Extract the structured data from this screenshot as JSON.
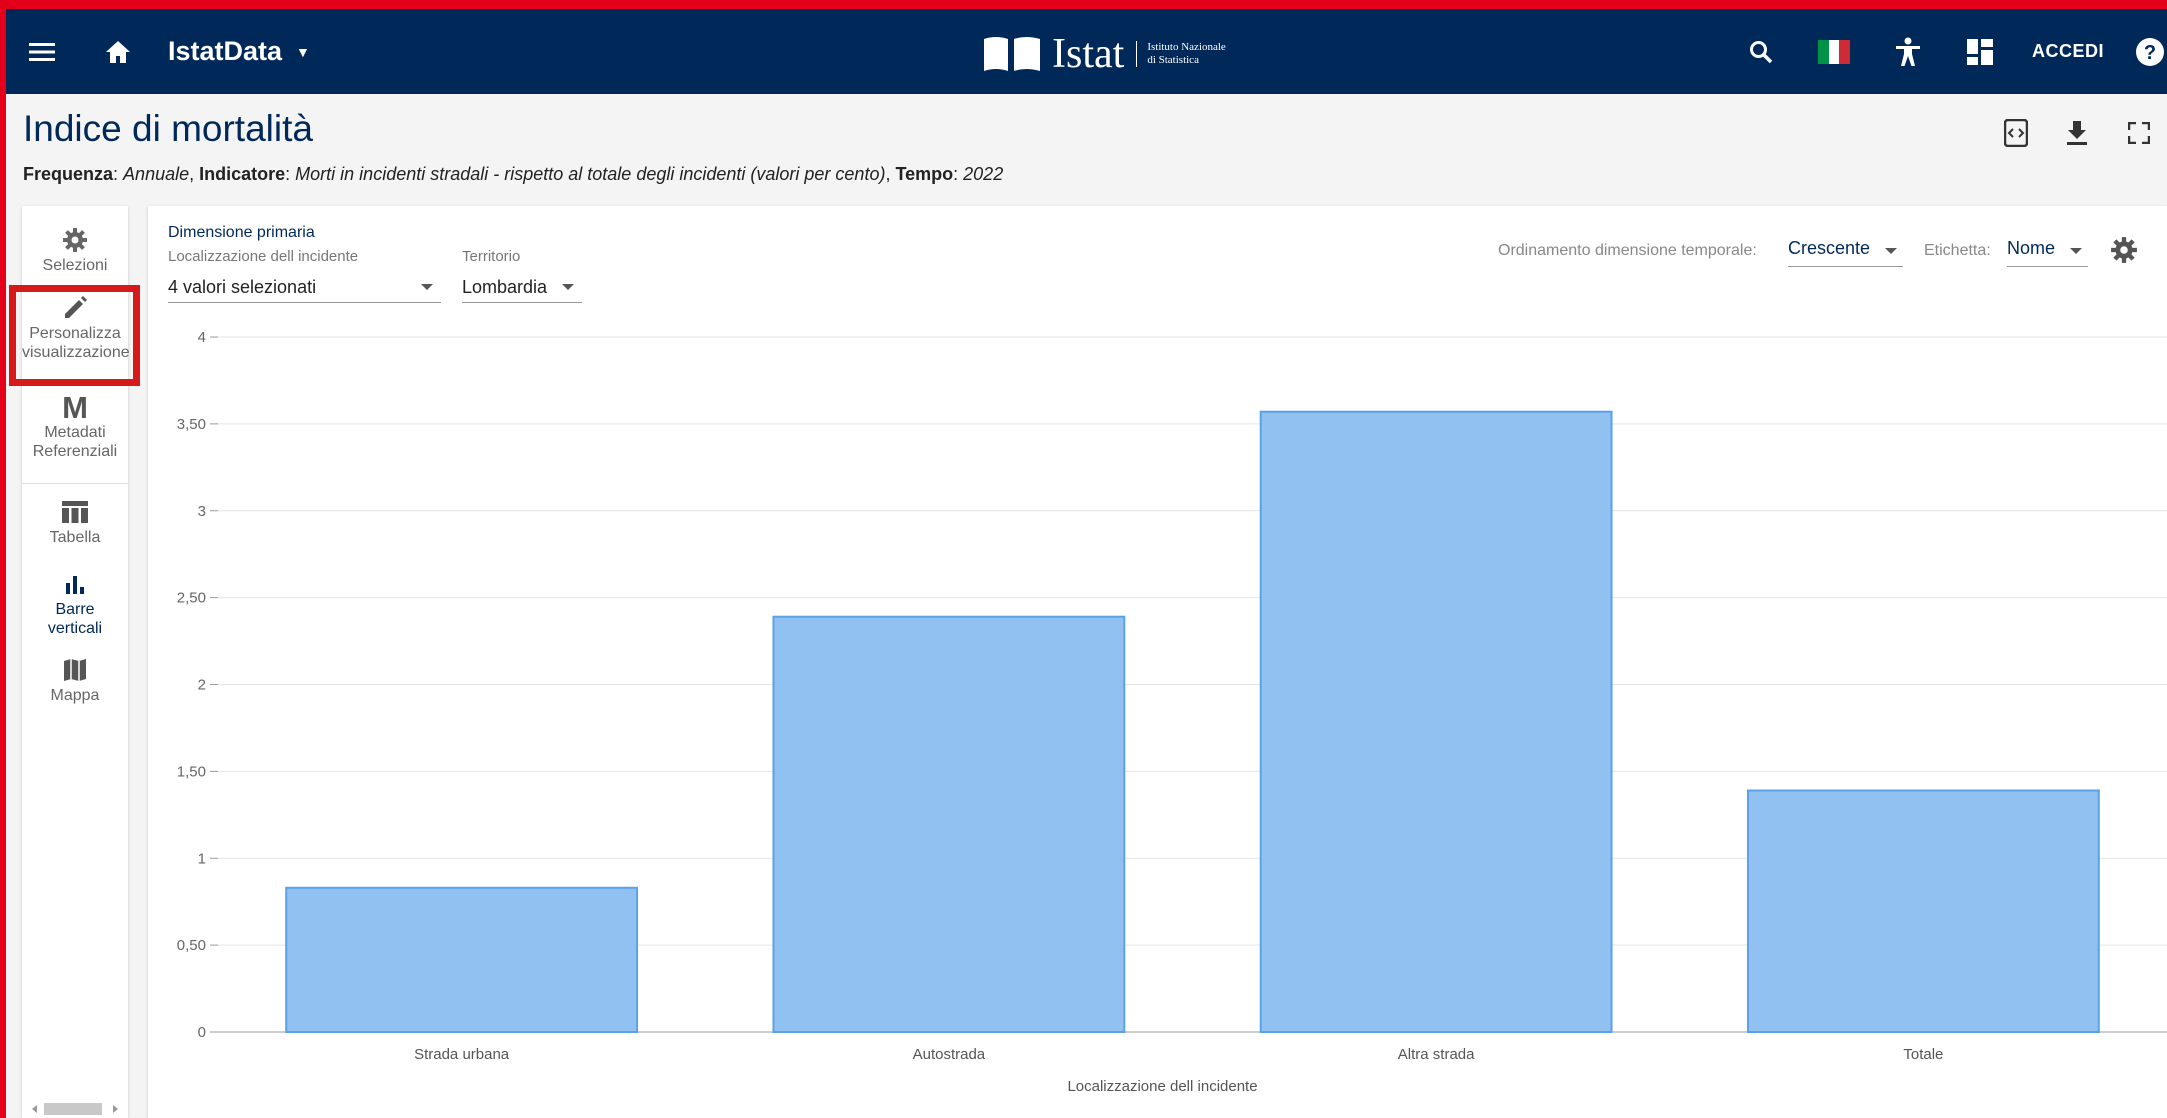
{
  "header": {
    "app_name": "IstatData",
    "logo_word": "Istat",
    "logo_sub_line1": "Istituto Nazionale",
    "logo_sub_line2": "di Statistica",
    "login_label": "ACCEDI",
    "colors": {
      "bar": "#00295a",
      "flag_green": "#009246",
      "flag_white": "#ffffff",
      "flag_red": "#ce2b37"
    }
  },
  "page": {
    "title": "Indice di mortalità",
    "subtitle": {
      "k1": "Frequenza",
      "v1": "Annuale",
      "k2": "Indicatore",
      "v2": "Morti in incidenti stradali - rispetto al totale degli incidenti (valori per cento)",
      "k3": "Tempo",
      "v3": "2022"
    }
  },
  "sidebar": {
    "items": [
      {
        "label": "Selezioni",
        "icon": "gear-icon"
      },
      {
        "label1": "Personalizza",
        "label2": "visualizzazione",
        "icon": "pencil-icon"
      },
      {
        "label1": "Metadati",
        "label2": "Referenziali",
        "icon": "m-icon",
        "glyph": "M"
      },
      {
        "label": "Tabella",
        "icon": "table-icon"
      },
      {
        "label1": "Barre",
        "label2": "verticali",
        "icon": "bar-chart-icon"
      },
      {
        "label": "Mappa",
        "icon": "map-icon"
      }
    ]
  },
  "controls": {
    "primary_dimension_label": "Dimensione primaria",
    "location_label": "Localizzazione dell incidente",
    "location_value": "4 valori selezionati",
    "territory_label": "Territorio",
    "territory_value": "Lombardia",
    "time_order_label": "Ordinamento dimensione temporale:",
    "time_order_value": "Crescente",
    "label_label": "Etichetta:",
    "label_value": "Nome"
  },
  "chart_data": {
    "type": "bar",
    "categories": [
      "Strada urbana",
      "Autostrada",
      "Altra strada",
      "Totale"
    ],
    "values": [
      0.83,
      2.39,
      3.57,
      1.39
    ],
    "xlabel": "Localizzazione dell incidente",
    "ylabel": "",
    "ylim": [
      0,
      4
    ],
    "yticks": [
      "0",
      "0,50",
      "1",
      "1,50",
      "2",
      "2,50",
      "3",
      "3,50",
      "4"
    ],
    "grid": true,
    "bar_color": "#90c1f0",
    "bar_border": "#5aa2e8"
  }
}
